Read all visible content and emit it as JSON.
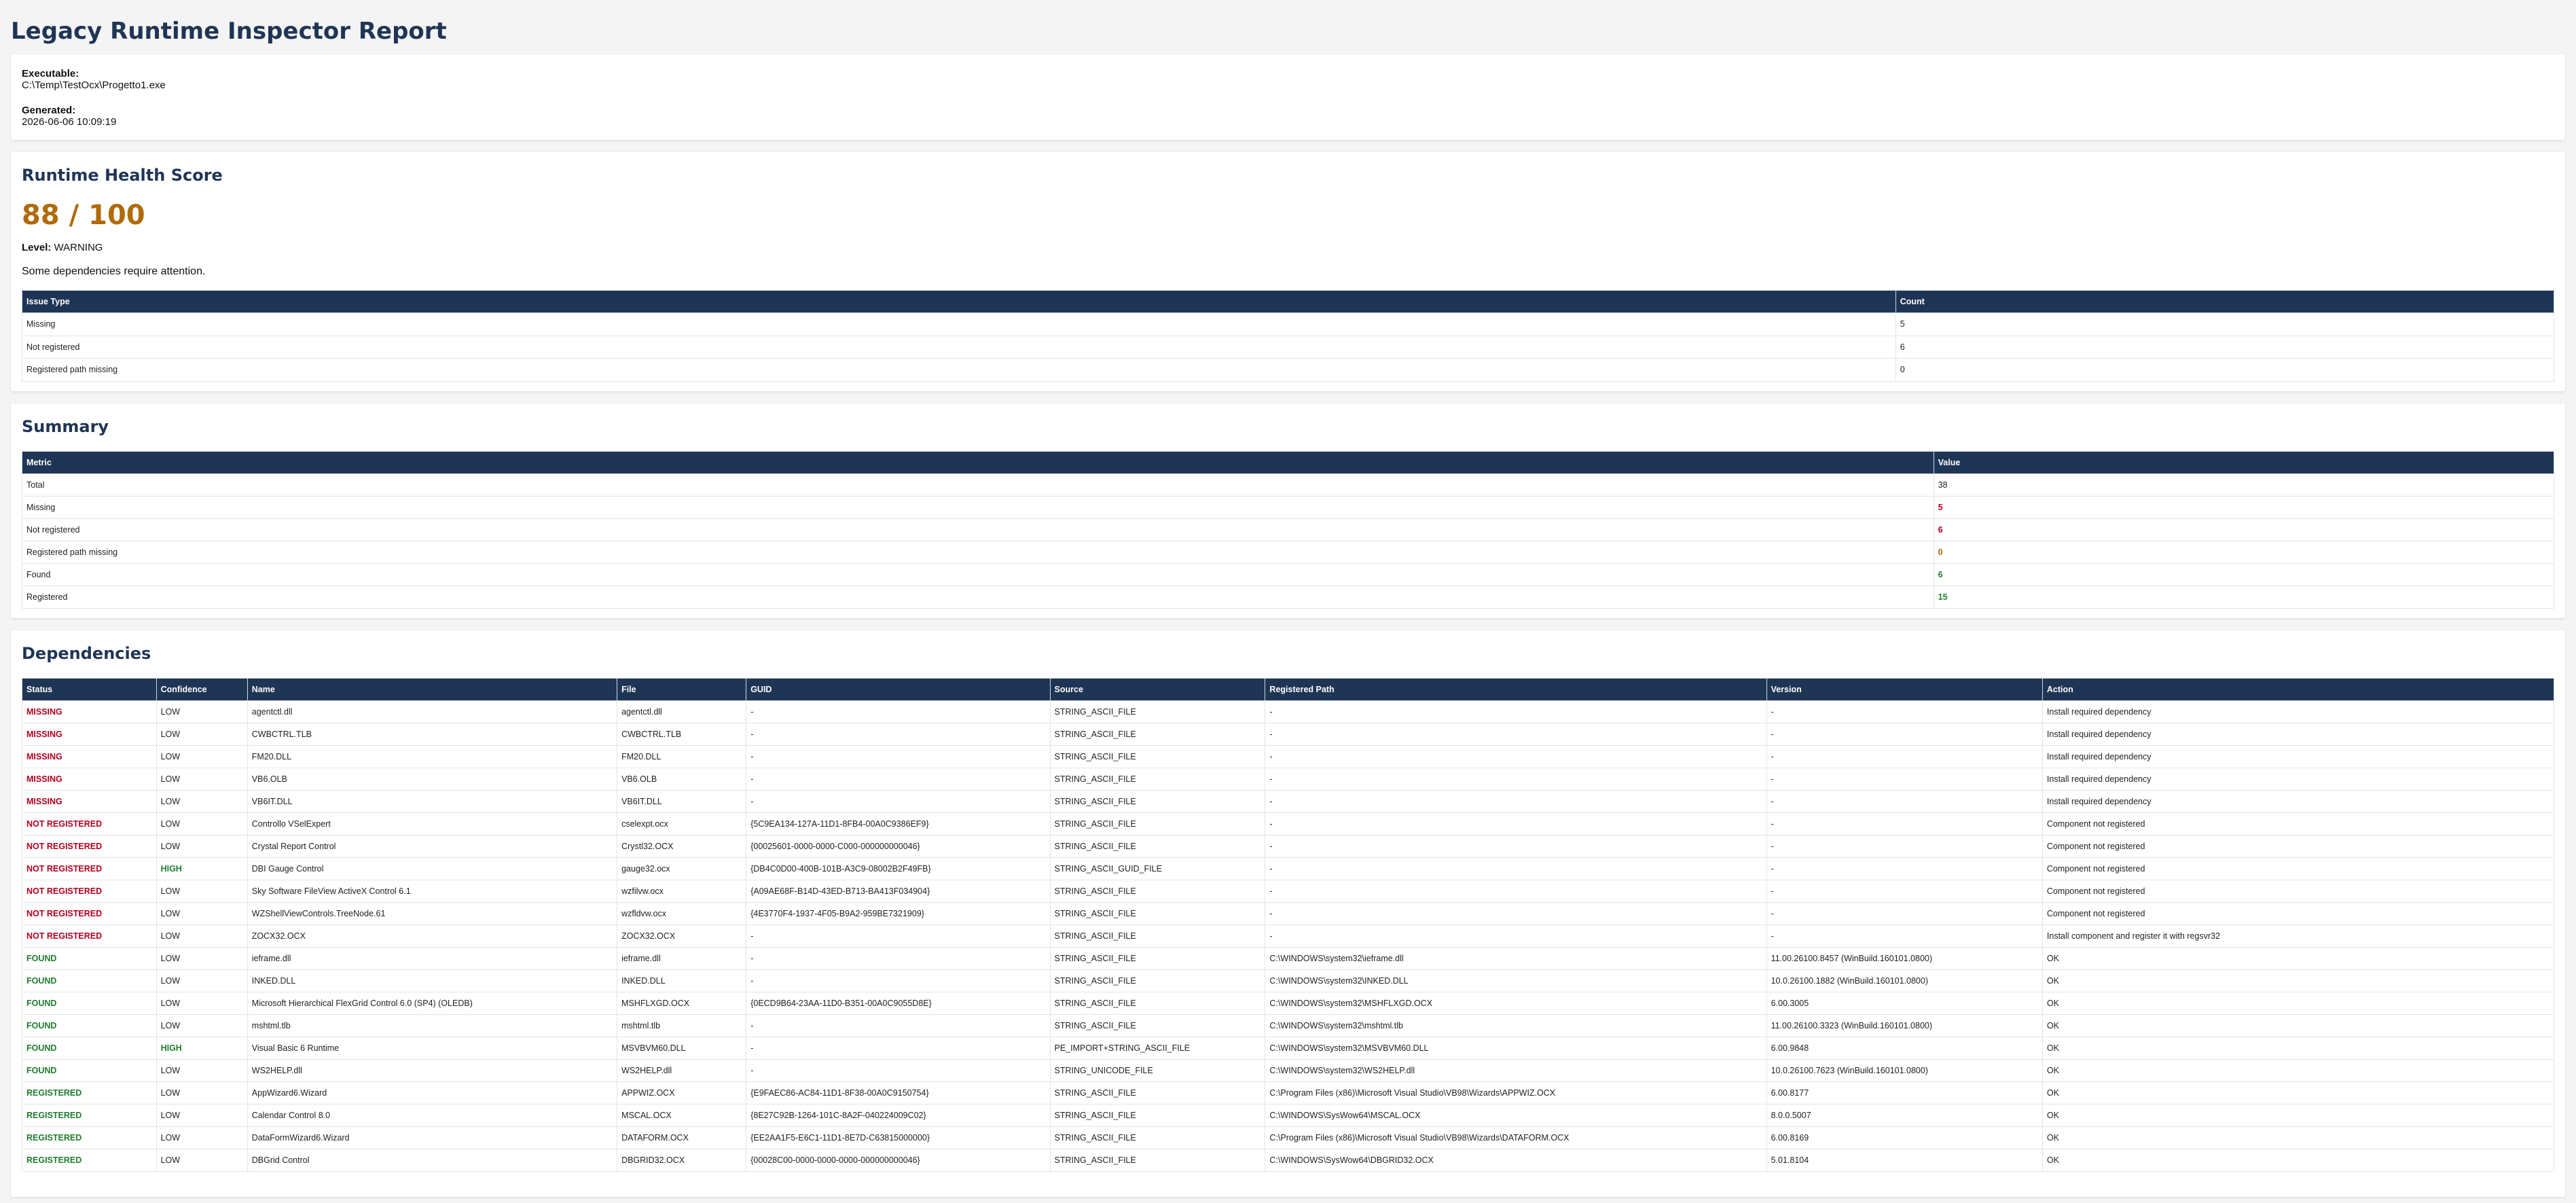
{
  "title": "Legacy Runtime Inspector Report",
  "meta": {
    "executable_label": "Executable:",
    "executable": "C:\\Temp\\TestOcx\\Progetto1.exe",
    "generated_label": "Generated:",
    "generated": "2026-06-06 10:09:19"
  },
  "health": {
    "heading": "Runtime Health Score",
    "score": "88 / 100",
    "level_label": "Level:",
    "level": "WARNING",
    "message": "Some dependencies require attention.",
    "columns": [
      "Issue Type",
      "Count"
    ],
    "rows": [
      [
        "Missing",
        "5"
      ],
      [
        "Not registered",
        "6"
      ],
      [
        "Registered path missing",
        "0"
      ]
    ]
  },
  "summary": {
    "heading": "Summary",
    "columns": [
      "Metric",
      "Value"
    ],
    "rows": [
      [
        "Total",
        "38"
      ],
      [
        "Missing",
        "5"
      ],
      [
        "Not registered",
        "6"
      ],
      [
        "Registered path missing",
        "0"
      ],
      [
        "Found",
        "6"
      ],
      [
        "Registered",
        "15"
      ]
    ]
  },
  "dependencies": {
    "heading": "Dependencies",
    "columns": [
      "Status",
      "Confidence",
      "Name",
      "File",
      "GUID",
      "Source",
      "Registered Path",
      "Version",
      "Action"
    ],
    "rows": [
      [
        "MISSING",
        "LOW",
        "agentctl.dll",
        "agentctl.dll",
        "-",
        "STRING_ASCII_FILE",
        "-",
        "-",
        "Install required dependency"
      ],
      [
        "MISSING",
        "LOW",
        "CWBCTRL.TLB",
        "CWBCTRL.TLB",
        "-",
        "STRING_ASCII_FILE",
        "-",
        "-",
        "Install required dependency"
      ],
      [
        "MISSING",
        "LOW",
        "FM20.DLL",
        "FM20.DLL",
        "-",
        "STRING_ASCII_FILE",
        "-",
        "-",
        "Install required dependency"
      ],
      [
        "MISSING",
        "LOW",
        "VB6.OLB",
        "VB6.OLB",
        "-",
        "STRING_ASCII_FILE",
        "-",
        "-",
        "Install required dependency"
      ],
      [
        "MISSING",
        "LOW",
        "VB6IT.DLL",
        "VB6IT.DLL",
        "-",
        "STRING_ASCII_FILE",
        "-",
        "-",
        "Install required dependency"
      ],
      [
        "NOT REGISTERED",
        "LOW",
        "Controllo VSelExpert",
        "cselexpt.ocx",
        "{5C9EA134-127A-11D1-8FB4-00A0C9386EF9}",
        "STRING_ASCII_FILE",
        "-",
        "-",
        "Component not registered"
      ],
      [
        "NOT REGISTERED",
        "LOW",
        "Crystal Report Control",
        "Crystl32.OCX",
        "{00025601-0000-0000-C000-000000000046}",
        "STRING_ASCII_FILE",
        "-",
        "-",
        "Component not registered"
      ],
      [
        "NOT REGISTERED",
        "HIGH",
        "DBI Gauge Control",
        "gauge32.ocx",
        "{DB4C0D00-400B-101B-A3C9-08002B2F49FB}",
        "STRING_ASCII_GUID_FILE",
        "-",
        "-",
        "Component not registered"
      ],
      [
        "NOT REGISTERED",
        "LOW",
        "Sky Software FileView ActiveX Control 6.1",
        "wzfilvw.ocx",
        "{A09AE68F-B14D-43ED-B713-BA413F034904}",
        "STRING_ASCII_FILE",
        "-",
        "-",
        "Component not registered"
      ],
      [
        "NOT REGISTERED",
        "LOW",
        "WZShellViewControls.TreeNode.61",
        "wzfldvw.ocx",
        "{4E3770F4-1937-4F05-B9A2-959BE7321909}",
        "STRING_ASCII_FILE",
        "-",
        "-",
        "Component not registered"
      ],
      [
        "NOT REGISTERED",
        "LOW",
        "ZOCX32.OCX",
        "ZOCX32.OCX",
        "-",
        "STRING_ASCII_FILE",
        "-",
        "-",
        "Install component and register it with regsvr32"
      ],
      [
        "FOUND",
        "LOW",
        "ieframe.dll",
        "ieframe.dll",
        "-",
        "STRING_ASCII_FILE",
        "C:\\WINDOWS\\system32\\ieframe.dll",
        "11.00.26100.8457 (WinBuild.160101.0800)",
        "OK"
      ],
      [
        "FOUND",
        "LOW",
        "INKED.DLL",
        "INKED.DLL",
        "-",
        "STRING_ASCII_FILE",
        "C:\\WINDOWS\\system32\\INKED.DLL",
        "10.0.26100.1882 (WinBuild.160101.0800)",
        "OK"
      ],
      [
        "FOUND",
        "LOW",
        "Microsoft Hierarchical FlexGrid Control 6.0 (SP4) (OLEDB)",
        "MSHFLXGD.OCX",
        "{0ECD9B64-23AA-11D0-B351-00A0C9055D8E}",
        "STRING_ASCII_FILE",
        "C:\\WINDOWS\\system32\\MSHFLXGD.OCX",
        "6.00.3005",
        "OK"
      ],
      [
        "FOUND",
        "LOW",
        "mshtml.tlb",
        "mshtml.tlb",
        "-",
        "STRING_ASCII_FILE",
        "C:\\WINDOWS\\system32\\mshtml.tlb",
        "11.00.26100.3323 (WinBuild.160101.0800)",
        "OK"
      ],
      [
        "FOUND",
        "HIGH",
        "Visual Basic 6 Runtime",
        "MSVBVM60.DLL",
        "-",
        "PE_IMPORT+STRING_ASCII_FILE",
        "C:\\WINDOWS\\system32\\MSVBVM60.DLL",
        "6.00.9848",
        "OK"
      ],
      [
        "FOUND",
        "LOW",
        "WS2HELP.dll",
        "WS2HELP.dll",
        "-",
        "STRING_UNICODE_FILE",
        "C:\\WINDOWS\\system32\\WS2HELP.dll",
        "10.0.26100.7623 (WinBuild.160101.0800)",
        "OK"
      ],
      [
        "REGISTERED",
        "LOW",
        "AppWizard6.Wizard",
        "APPWIZ.OCX",
        "{E9FAEC86-AC84-11D1-8F38-00A0C9150754}",
        "STRING_ASCII_FILE",
        "C:\\Program Files (x86)\\Microsoft Visual Studio\\VB98\\Wizards\\APPWIZ.OCX",
        "6.00.8177",
        "OK"
      ],
      [
        "REGISTERED",
        "LOW",
        "Calendar Control 8.0",
        "MSCAL.OCX",
        "{8E27C92B-1264-101C-8A2F-040224009C02}",
        "STRING_ASCII_FILE",
        "C:\\WINDOWS\\SysWow64\\MSCAL.OCX",
        "8.0.0.5007",
        "OK"
      ],
      [
        "REGISTERED",
        "LOW",
        "DataFormWizard6.Wizard",
        "DATAFORM.OCX",
        "{EE2AA1F5-E6C1-11D1-8E7D-C63815000000}",
        "STRING_ASCII_FILE",
        "C:\\Program Files (x86)\\Microsoft Visual Studio\\VB98\\Wizards\\DATAFORM.OCX",
        "6.00.8169",
        "OK"
      ],
      [
        "REGISTERED",
        "LOW",
        "DBGrid Control",
        "DBGRID32.OCX",
        "{00028C00-0000-0000-0000-000000000046}",
        "STRING_ASCII_FILE",
        "C:\\WINDOWS\\SysWow64\\DBGRID32.OCX",
        "5.01.8104",
        "OK"
      ]
    ]
  },
  "colors": {
    "heading": "#1f3556",
    "header_bg": "#1f3556",
    "warning": "#b06a09",
    "missing": "#b00020",
    "found": "#1e7d2e"
  }
}
